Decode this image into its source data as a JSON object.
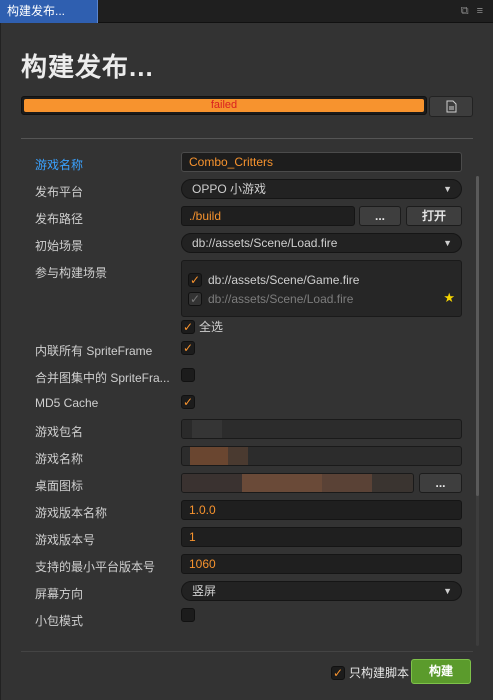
{
  "tab": {
    "title": "构建发布..."
  },
  "title": "构建发布...",
  "progress": {
    "percent": 100,
    "status": "failed",
    "color": "#f7932e",
    "status_color": "#d92020"
  },
  "form": {
    "game_name_label": "游戏名称",
    "game_name_value": "Combo_Critters",
    "platform_label": "发布平台",
    "platform_value": "OPPO 小游戏",
    "build_path_label": "发布路径",
    "build_path_value": "./build",
    "browse_label": "...",
    "open_label": "打开",
    "start_scene_label": "初始场景",
    "start_scene_value": "db://assets/Scene/Load.fire",
    "scenes_label": "参与构建场景",
    "scenes": [
      {
        "path": "db://assets/Scene/Game.fire",
        "checked": true,
        "start": false
      },
      {
        "path": "db://assets/Scene/Load.fire",
        "checked": true,
        "start": true
      }
    ],
    "select_all_label": "全选",
    "inline_sprite_label": "内联所有 SpriteFrame",
    "merge_atlas_label": "合并图集中的 SpriteFra...",
    "md5_label": "MD5 Cache",
    "package_name_label": "游戏包名",
    "game_name2_label": "游戏名称",
    "desktop_icon_label": "桌面图标",
    "icon_browse_label": "...",
    "version_name_label": "游戏版本名称",
    "version_name_value": "1.0.0",
    "version_code_label": "游戏版本号",
    "version_code_value": "1",
    "min_platform_label": "支持的最小平台版本号",
    "min_platform_value": "1060",
    "orientation_label": "屏幕方向",
    "orientation_value": "竖屏",
    "small_pkg_label": "小包模式"
  },
  "footer": {
    "only_script_label": "只构建脚本",
    "build_label": "构建"
  },
  "colors": {
    "accent": "#f7932e",
    "link": "#3aa2ff",
    "build_green": "#5b9b2c"
  },
  "icons": [
    "restore-icon",
    "menu-icon",
    "log-file-icon",
    "checkmark-icon",
    "star-icon",
    "caret-down-icon"
  ]
}
